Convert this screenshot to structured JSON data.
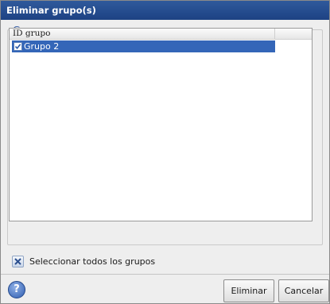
{
  "window": {
    "title": "Eliminar grupo(s)"
  },
  "groups_panel": {
    "legend": "Grupos:",
    "column_header": "ID grupo",
    "rows": [
      {
        "label": "Grupo 2",
        "checked": true,
        "selected": true
      }
    ]
  },
  "select_all": {
    "label": "Seleccionar todos los grupos"
  },
  "footer": {
    "help_glyph": "?",
    "delete_label": "Eliminar",
    "cancel_label": "Cancelar"
  },
  "colors": {
    "title_bar": "#1d4283",
    "selection": "#3466b8",
    "legend_text": "#3c62a6"
  }
}
